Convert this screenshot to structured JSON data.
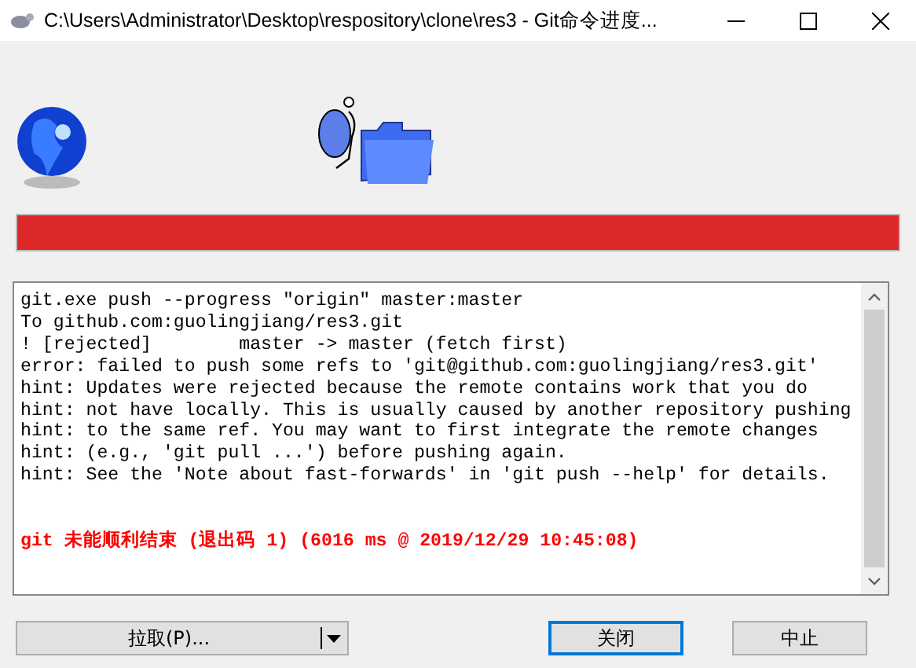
{
  "window": {
    "title": "C:\\Users\\Administrator\\Desktop\\respository\\clone\\res3 - Git命令进度..."
  },
  "progress": {
    "level": 1,
    "failed": true
  },
  "log": {
    "lines": [
      "git.exe push --progress \"origin\" master:master",
      "To github.com:guolingjiang/res3.git",
      "! [rejected]        master -> master (fetch first)",
      "error: failed to push some refs to 'git@github.com:guolingjiang/res3.git'",
      "hint: Updates were rejected because the remote contains work that you do",
      "hint: not have locally. This is usually caused by another repository pushing",
      "hint: to the same ref. You may want to first integrate the remote changes",
      "hint: (e.g., 'git pull ...') before pushing again.",
      "hint: See the 'Note about fast-forwards' in 'git push --help' for details."
    ],
    "result": {
      "kind": "error",
      "text": "git 未能顺利结束 (退出码 1) (6016 ms @ 2019/12/29 10:45:08)"
    }
  },
  "buttons": [
    {
      "kind": "split",
      "label": "拉取(P)...",
      "default": false
    },
    {
      "kind": "plain",
      "label": "关闭",
      "default": true
    },
    {
      "kind": "plain",
      "label": "中止",
      "default": false
    }
  ]
}
